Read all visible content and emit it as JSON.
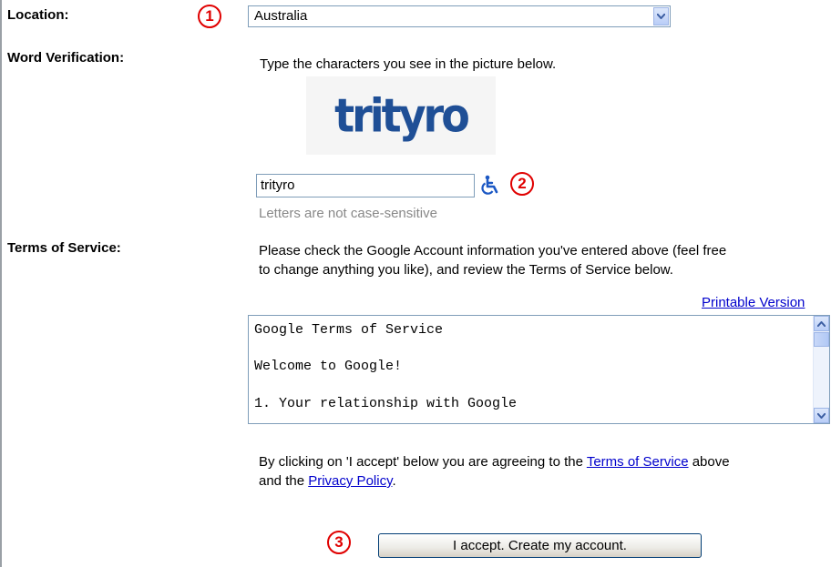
{
  "labels": {
    "location": "Location:",
    "word_verification": "Word Verification:",
    "terms_of_service": "Terms of Service:"
  },
  "markers": [
    "1",
    "2",
    "3"
  ],
  "location": {
    "selected": "Australia",
    "icon": "chevron-down-icon"
  },
  "word_verification": {
    "instruction": "Type the characters you see in the picture below.",
    "captcha_text": "trityro",
    "input_value": "trityro",
    "hint": "Letters are not case-sensitive",
    "accessibility_icon": "wheelchair-icon"
  },
  "terms": {
    "intro_line1": "Please check the Google Account information you've entered above (feel free",
    "intro_line2": "to change anything you like), and review the Terms of Service below.",
    "printable_link": "Printable Version",
    "box_lines": [
      "Google Terms of Service",
      "Welcome to Google!",
      "1. Your relationship with Google"
    ],
    "agree_pre": "By clicking on 'I accept' below you are agreeing to the ",
    "agree_tos_link": "Terms of Service",
    "agree_mid": " above",
    "agree_line2_pre": "and the ",
    "agree_privacy_link": "Privacy Policy",
    "agree_end": "."
  },
  "accept_button": "I accept. Create my account.",
  "colors": {
    "marker": "#e00000",
    "link": "#0000cc",
    "captcha": "#1f4f96"
  }
}
